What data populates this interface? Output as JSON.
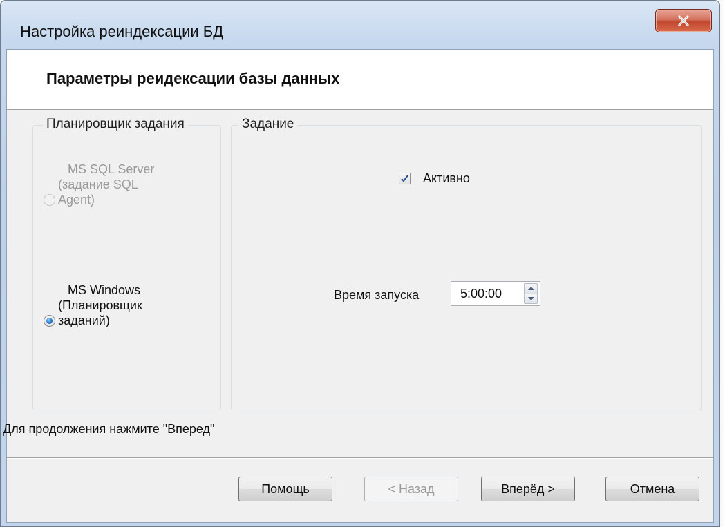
{
  "window": {
    "title": "Настройка реиндексации БД",
    "close_glyph": "✕"
  },
  "header": {
    "title": "Параметры реидексации базы данных"
  },
  "scheduler_group": {
    "legend": "Планировщик задания",
    "options": [
      {
        "lines": [
          "MS SQL Server",
          "(задание SQL",
          "Agent)"
        ],
        "checked": false,
        "enabled": false
      },
      {
        "lines": [
          "MS Windows",
          "(Планировщик",
          "заданий)"
        ],
        "checked": true,
        "enabled": true
      }
    ]
  },
  "task_group": {
    "legend": "Задание",
    "active_label": "Активно",
    "active_checked": true,
    "start_time_label": "Время запуска",
    "start_time_value": "5:00:00"
  },
  "hint": "Для продолжения нажмите \"Вперед\"",
  "buttons": {
    "help": "Помощь",
    "back": "< Назад",
    "next": "Вперёд >",
    "cancel": "Отмена"
  },
  "icons": {
    "close": "close-icon",
    "check": "checkmark-icon",
    "spin_up": "arrow-up-icon",
    "spin_down": "arrow-down-icon"
  }
}
